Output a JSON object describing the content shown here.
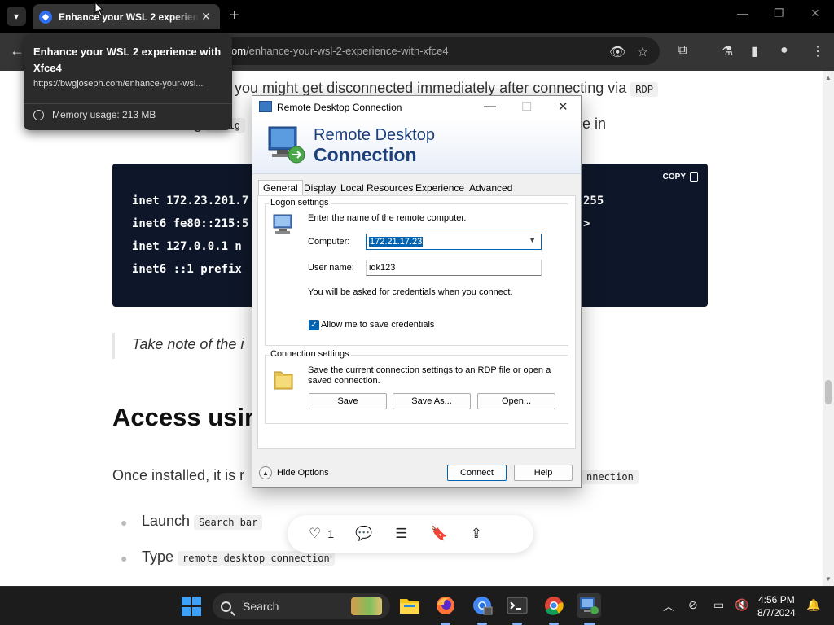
{
  "browser": {
    "tab_title": "Enhance your WSL 2 experience with Xfce4",
    "url_host": "om",
    "url_path": "/enhance-your-wsl-2-experience-with-xfce4",
    "hover_card": {
      "title": "Enhance your WSL 2 experience with Xfce4",
      "url": "https://bwgjoseph.com/enhance-your-wsl...",
      "memory": "Memory usage: 213 MB"
    }
  },
  "article": {
    "para1_text": "you might get disconnected immediately after connecting via",
    "para1_code": "RDP",
    "para2_prefix": "g",
    "para2_code": "onfig",
    "para2_suffix": "e in",
    "copy_label": "COPY",
    "code_lines": [
      "inet 172.23.201.7",
      "inet6 fe80::215:5",
      "inet 127.0.0.1  n",
      "inet6 ::1  prefix"
    ],
    "code_right": [
      "255",
      ">"
    ],
    "quote": "Take note of the i",
    "heading": "Access usir",
    "para3": "Once installed, it is r",
    "para3_code": "nnection",
    "bullets": [
      {
        "label": "Launch",
        "code": "Search bar"
      },
      {
        "label": "Type",
        "code": "remote desktop connection"
      }
    ],
    "like_count": "1"
  },
  "rdp": {
    "window_title": "Remote Desktop Connection",
    "banner_line1": "Remote Desktop",
    "banner_line2": "Connection",
    "tabs": [
      "General",
      "Display",
      "Local Resources",
      "Experience",
      "Advanced"
    ],
    "active_tab": "General",
    "logon_settings_label": "Logon settings",
    "logon_hint": "Enter the name of the remote computer.",
    "computer_label": "Computer:",
    "computer_value": "172.21.17.23",
    "username_label": "User name:",
    "username_value": "idk123",
    "credentials_note": "You will be asked for credentials when you connect.",
    "allow_save_label": "Allow me to save credentials",
    "allow_save_checked": true,
    "connection_settings_label": "Connection settings",
    "connection_hint": "Save the current connection settings to an RDP file or open a saved connection.",
    "save_button": "Save",
    "save_as_button": "Save As...",
    "open_button": "Open...",
    "hide_options": "Hide Options",
    "connect_button": "Connect",
    "help_button": "Help"
  },
  "taskbar": {
    "search_placeholder": "Search",
    "time": "4:56 PM",
    "date": "8/7/2024"
  },
  "colors": {
    "accent": "#0063b1",
    "code_bg": "#0e1729",
    "chrome_toolbar": "#353535"
  }
}
